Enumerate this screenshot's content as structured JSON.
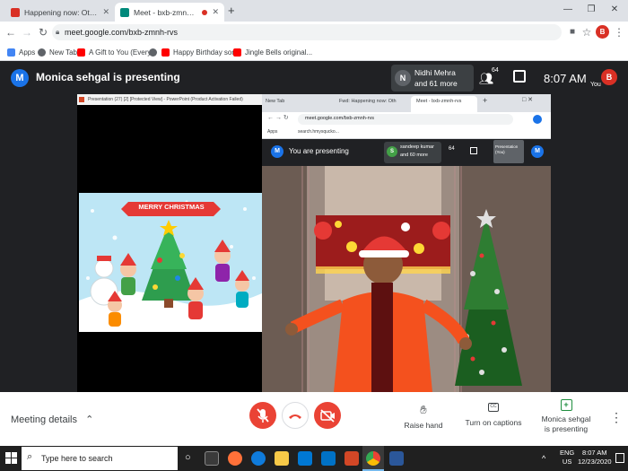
{
  "browser": {
    "tabs": [
      {
        "title": "Happening now: Othilia Fernand",
        "active": false
      },
      {
        "title": "Meet - bxb-zmnh-rvs",
        "active": true
      }
    ],
    "new_tab_symbol": "+",
    "url": "meet.google.com/bxb-zmnh-rvs",
    "profile_initial": "B",
    "bookmarks": [
      "Apps",
      "New Tab",
      "A Gift to You (Every...",
      "Happy Birthday son...",
      "Jingle Bells original..."
    ]
  },
  "meet": {
    "presenter_initial": "M",
    "presenter_label": "Monica sehgal is presenting",
    "participant_initial": "N",
    "participant_name": "Nidhi Mehra",
    "participant_more": "and 61 more",
    "people_count": "64",
    "time": "8:07 AM",
    "you_label": "You",
    "self_initial": "B",
    "meeting_details": "Meeting details",
    "raise_hand": "Raise hand",
    "captions": "Turn on captions",
    "presenting_line1": "Monica sehgal",
    "presenting_line2": "is presenting"
  },
  "shared_screen": {
    "ppt_title": "Presentation (27) [2] [Protected View] - PowerPoint (Product Activation Failed)",
    "slide_banner": "MERRY CHRISTMAS",
    "inner_tabs": [
      "New Tab",
      "Fwd: Happening now: Oth",
      "Meet - bxb-zmnh-rvs"
    ],
    "inner_url": "meet.google.com/bxb-zmnh-rvs",
    "inner_bookmark_apps": "Apps",
    "inner_bookmark_search": "search.hmysqucko...",
    "inner_presenter_initial": "M",
    "inner_presenting": "You are presenting",
    "inner_participant_initial": "S",
    "inner_participant_name": "sandeep kumar",
    "inner_participant_more": "and 60 more",
    "inner_people_count": "64",
    "inner_presentation_label": "Presentation (You)",
    "inner_self_initial": "M"
  },
  "taskbar": {
    "search_placeholder": "Type here to search",
    "lang_line1": "ENG",
    "lang_line2": "US",
    "time": "8:07 AM",
    "date": "12/23/2020"
  }
}
